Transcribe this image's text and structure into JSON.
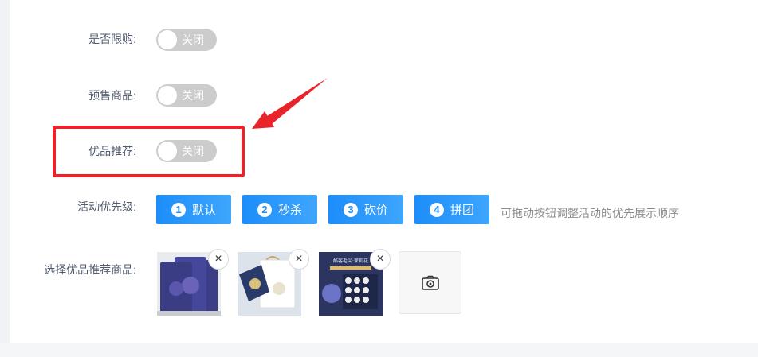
{
  "form": {
    "purchase_limit": {
      "label": "是否限购:",
      "toggle_text": "关闭"
    },
    "presale": {
      "label": "预售商品:",
      "toggle_text": "关闭"
    },
    "recommend": {
      "label": "优品推荐:",
      "toggle_text": "关闭"
    },
    "priority": {
      "label": "活动优先级:",
      "buttons": [
        {
          "num": "1",
          "label": "默认"
        },
        {
          "num": "2",
          "label": "秒杀"
        },
        {
          "num": "3",
          "label": "砍价"
        },
        {
          "num": "4",
          "label": "拼团"
        }
      ],
      "hint": "可拖动按钮调整活动的优先展示顺序"
    },
    "recommend_products": {
      "label": "选择优品推荐商品:",
      "remove_symbol": "×",
      "thumb2_caption": "",
      "thumb3_caption": "酷客毛尖·茉莉花"
    }
  },
  "colors": {
    "accent": "#1c8dfa",
    "toggle_off": "#cccccc",
    "highlight": "#e8242a"
  },
  "icons": {
    "upload": "camera-icon",
    "remove": "close-icon"
  }
}
